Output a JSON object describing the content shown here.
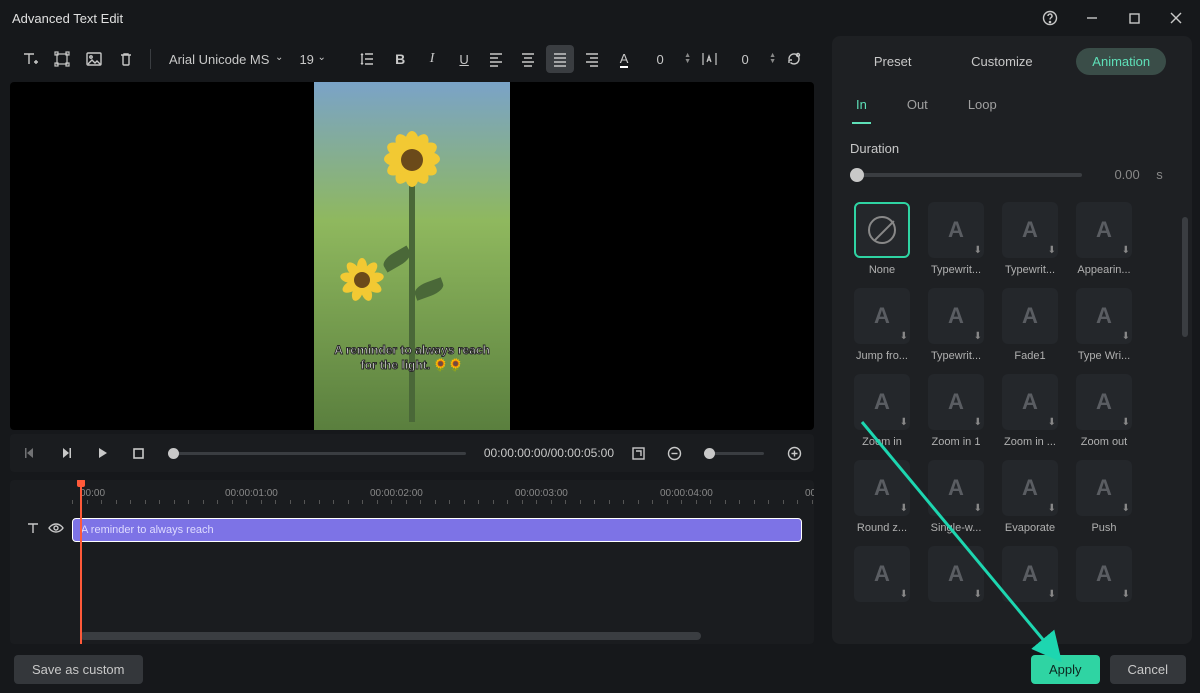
{
  "window": {
    "title": "Advanced Text Edit"
  },
  "toolbar": {
    "font_family": "Arial Unicode MS",
    "font_size": "19",
    "letter_spacing": "0",
    "line_height": "0"
  },
  "preview": {
    "caption_line1": "A reminder to always reach",
    "caption_line2": "for the light. 🌻🌻"
  },
  "playback": {
    "time_display": "00:00:00:00/00:00:05:00"
  },
  "timeline": {
    "marks": [
      "00:00",
      "00:00:01:00",
      "00:00:02:00",
      "00:00:03:00",
      "00:00:04:00",
      "00:00:0"
    ],
    "clip_label": "A reminder to always reach"
  },
  "panel": {
    "tabs": [
      "Preset",
      "Customize",
      "Animation"
    ],
    "subtabs": [
      "In",
      "Out",
      "Loop"
    ],
    "duration_label": "Duration",
    "duration_value": "0.00",
    "duration_unit": "s",
    "animations": [
      "None",
      "Typewrit...",
      "Typewrit...",
      "Appearin...",
      "Jump fro...",
      "Typewrit...",
      "Fade1",
      "Type Wri...",
      "Zoom in",
      "Zoom in 1",
      "Zoom in ...",
      "Zoom out",
      "Round z...",
      "Single-w...",
      "Evaporate",
      "Push",
      "",
      "",
      "",
      ""
    ]
  },
  "footer": {
    "save_custom": "Save as custom",
    "apply": "Apply",
    "cancel": "Cancel"
  }
}
